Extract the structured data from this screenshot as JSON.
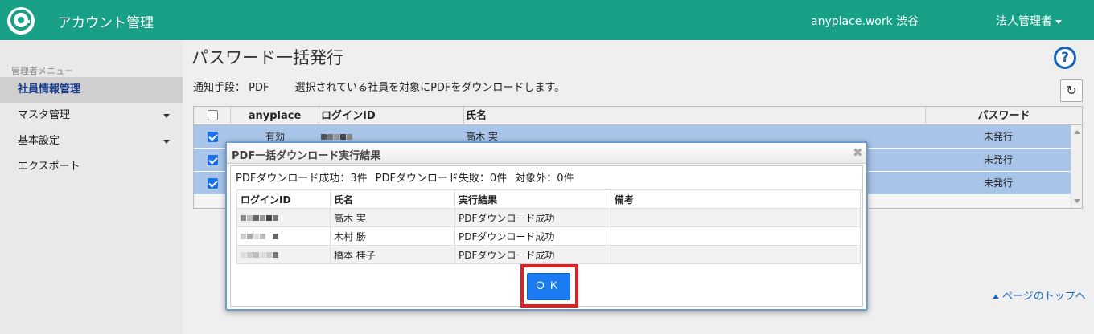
{
  "header": {
    "app_title": "アカウント管理",
    "location": "anyplace.work 渋谷",
    "user_menu": "法人管理者",
    "brand_color": "#17a085"
  },
  "sidebar": {
    "heading": "管理者メニュー",
    "items": [
      {
        "label": "社員情報管理",
        "active": true
      },
      {
        "label": "マスタ管理",
        "has_submenu": true
      },
      {
        "label": "基本設定",
        "has_submenu": true
      },
      {
        "label": "エクスポート"
      }
    ]
  },
  "main": {
    "title": "パスワード一括発行",
    "notice_method": "通知手段： PDF",
    "notice_text": "選択されている社員を対象にPDFをダウンロードします。",
    "page_top": "ページのトップへ"
  },
  "bg_table": {
    "headers": [
      "anyplace",
      "ログインID",
      "氏名",
      "パスワード"
    ],
    "rows": [
      {
        "status": "有効",
        "name": "高木 実",
        "password": "未発行",
        "checked": true
      },
      {
        "status": "",
        "name": "",
        "password": "未発行",
        "checked": true
      },
      {
        "status": "",
        "name": "",
        "password": "未発行",
        "checked": true
      }
    ]
  },
  "dialog": {
    "title": "PDF一括ダウンロード実行結果",
    "summary_success": "PDFダウンロード成功：3件",
    "summary_fail": "PDFダウンロード失敗：0件",
    "summary_excluded": "対象外：0件",
    "headers": [
      "ログインID",
      "氏名",
      "実行結果",
      "備考"
    ],
    "rows": [
      {
        "name": "高木 実",
        "result": "PDFダウンロード成功",
        "note": ""
      },
      {
        "name": "木村 勝",
        "result": "PDFダウンロード成功",
        "note": ""
      },
      {
        "name": "橋本 桂子",
        "result": "PDFダウンロード成功",
        "note": ""
      }
    ],
    "ok_label": "ＯＫ"
  }
}
